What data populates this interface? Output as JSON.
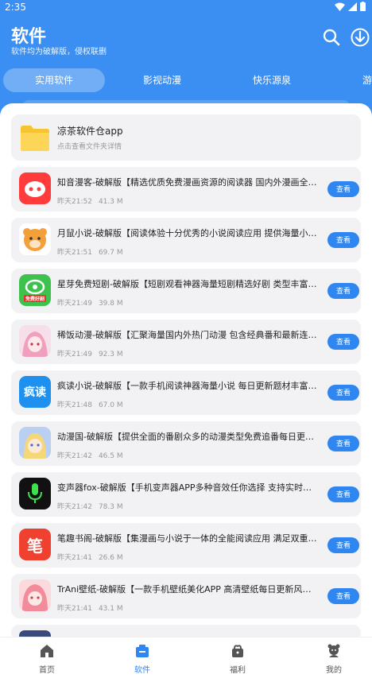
{
  "status_bar": {
    "time": "2:35"
  },
  "header": {
    "title": "软件",
    "subtitle": "软件均为破解版，侵权联删",
    "icons": [
      "search-icon",
      "download-icon"
    ]
  },
  "tabs": [
    {
      "label": "实用软件",
      "active": true
    },
    {
      "label": "影视动漫",
      "active": false
    },
    {
      "label": "快乐源泉",
      "active": false
    },
    {
      "label": "游",
      "active": false
    }
  ],
  "folder": {
    "title": "凉茶软件仓app",
    "subtitle": "点击查看文件夹详情"
  },
  "apps": [
    {
      "title": "知音漫客-破解版【精选优质免费漫画资源的阅读器 国内外漫画全…",
      "time": "昨天21:52",
      "size": "41.3 M",
      "button": "查看",
      "icon_bg": "#ff3b3b",
      "icon_text": "",
      "icon": "zhiyin-icon"
    },
    {
      "title": "月鼠小说-破解版【阅读体验十分优秀的小说阅读应用 提供海量小…",
      "time": "昨天21:51",
      "size": "69.7 M",
      "button": "查看",
      "icon_bg": "#f4a03a",
      "icon_text": "",
      "icon": "yueshu-icon"
    },
    {
      "title": "星芽免费短剧-破解版【短剧观看神器海量短剧精选好剧 类型丰富…",
      "time": "昨天21:49",
      "size": "39.8 M",
      "button": "查看",
      "icon_bg": "#3ec24e",
      "icon_text": "免费好剧",
      "icon": "xingya-icon"
    },
    {
      "title": "稀饭动漫-破解版【汇聚海量国内外热门动漫 包含经典番和最新连…",
      "time": "昨天21:49",
      "size": "92.3 M",
      "button": "查看",
      "icon_bg": "#f0c8d8",
      "icon_text": "",
      "icon": "xifan-icon"
    },
    {
      "title": "疯读小说-破解版【一款手机阅读神器海量小说 每日更新题材丰富…",
      "time": "昨天21:48",
      "size": "67.0 M",
      "button": "查看",
      "icon_bg": "#1e90f0",
      "icon_text": "疯读",
      "icon": "fengdu-icon"
    },
    {
      "title": "动漫国-破解版【提供全面的番剧众多的动漫类型免费追番每日更…",
      "time": "昨天21:42",
      "size": "46.5 M",
      "button": "查看",
      "icon_bg": "#a9c4ee",
      "icon_text": "",
      "icon": "dongmanguo-icon"
    },
    {
      "title": "变声器fox-破解版【手机变声器APP多种音效任你选择 支持实时变…",
      "time": "昨天21:42",
      "size": "78.3 M",
      "button": "查看",
      "icon_bg": "#111111",
      "icon_text": "",
      "icon": "microphone-icon"
    },
    {
      "title": "笔趣书阁-破解版【集漫画与小说于一体的全能阅读应用 满足双重…",
      "time": "昨天21:41",
      "size": "26.6 M",
      "button": "查看",
      "icon_bg": "#f04030",
      "icon_text": "笔",
      "icon": "biqu-icon"
    },
    {
      "title": "TrAni壁纸-破解版【一款手机壁纸美化APP 高清壁纸每日更新风格…",
      "time": "昨天21:41",
      "size": "43.1 M",
      "button": "查看",
      "icon_bg": "#f4b0b8",
      "icon_text": "",
      "icon": "trani-icon"
    }
  ],
  "bottom_nav": [
    {
      "label": "首页",
      "icon": "home-icon",
      "active": false
    },
    {
      "label": "软件",
      "icon": "software-icon",
      "active": true
    },
    {
      "label": "福利",
      "icon": "gift-icon",
      "active": false
    },
    {
      "label": "我的",
      "icon": "profile-icon",
      "active": false
    }
  ],
  "colors": {
    "primary": "#3b8ff2",
    "button": "#2f86f0",
    "card": "#f2f2f4"
  }
}
